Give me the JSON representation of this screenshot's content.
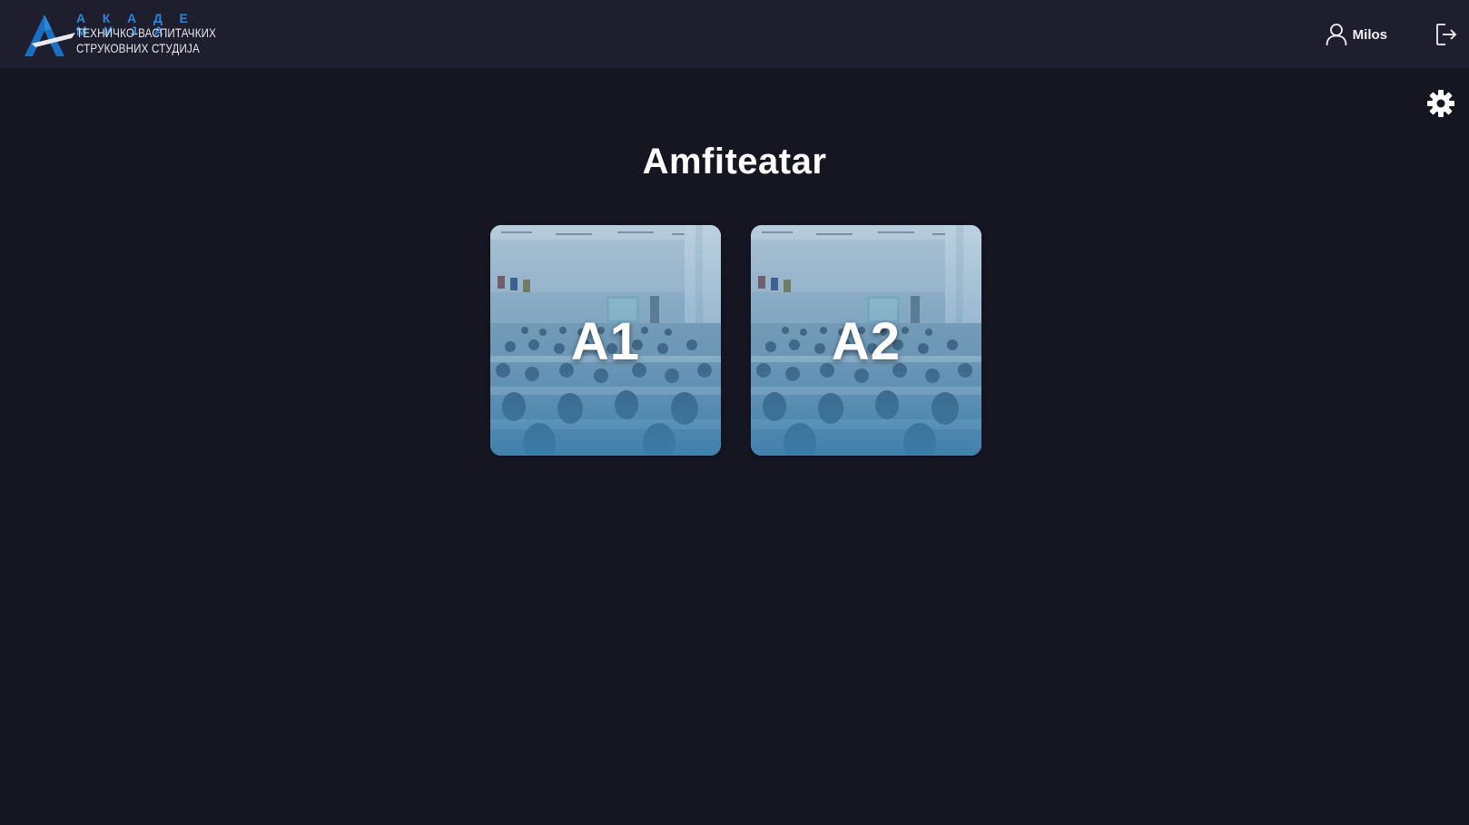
{
  "header": {
    "logo": {
      "line1": "А К А Д Е М И Ј А",
      "line2": "ТЕХНИЧКО-ВАСПИТАЧКИХ",
      "line3": "СТРУКОВНИХ СТУДИЈА"
    },
    "user": {
      "name": "Milos",
      "icon": "user-icon"
    },
    "logout_icon": "logout-icon"
  },
  "main": {
    "title": "Amfiteatar",
    "settings_icon": "gear-icon",
    "rooms": [
      {
        "label": "A1"
      },
      {
        "label": "A2"
      }
    ]
  },
  "colors": {
    "background": "#161622",
    "header_bg": "#1e1e2e",
    "logo_accent": "#2a86d8",
    "card_tint": "#3e7fab",
    "text": "#ffffff"
  }
}
